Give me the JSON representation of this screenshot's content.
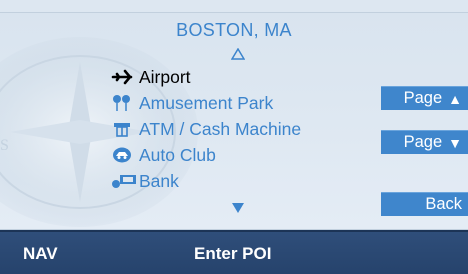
{
  "header": {
    "city": "BOSTON, MA"
  },
  "poi_list": [
    {
      "label": "Airport",
      "icon": "airplane-icon",
      "selected": true
    },
    {
      "label": "Amusement Park",
      "icon": "amusement-park-icon",
      "selected": false
    },
    {
      "label": "ATM / Cash Machine",
      "icon": "atm-icon",
      "selected": false
    },
    {
      "label": "Auto Club",
      "icon": "auto-club-icon",
      "selected": false
    },
    {
      "label": "Bank",
      "icon": "bank-icon",
      "selected": false
    }
  ],
  "buttons": {
    "page_up": "Page",
    "page_down": "Page",
    "back": "Back"
  },
  "status_bar": {
    "mode": "NAV",
    "title": "Enter POI"
  },
  "colors": {
    "accent": "#3c84cc",
    "button": "#3f86cc",
    "status_bar": "#2a4770",
    "background": "#dde7f1",
    "selected_text": "#000000"
  }
}
